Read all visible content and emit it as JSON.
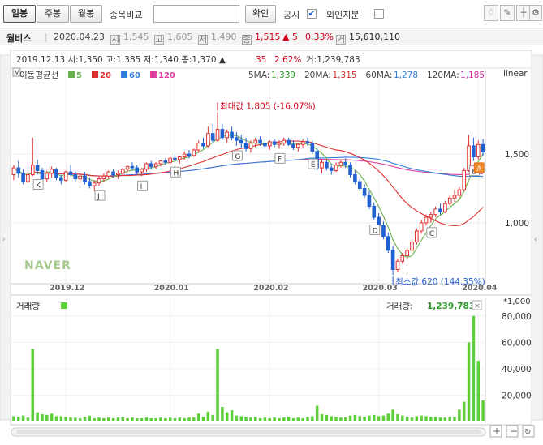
{
  "toolbar": {
    "period_buttons": [
      "일봉",
      "주봉",
      "월봉"
    ],
    "compare_label": "종목비교",
    "confirm_label": "확인",
    "disclosure_label": "공시",
    "foreign_label": "외인지분"
  },
  "info": {
    "name": "월비스",
    "date": "2020.04.23",
    "open": "1,545",
    "high": "1,605",
    "low": "1,490",
    "close": "1,515",
    "change": "▲ 5",
    "pct": "0.33%",
    "volume": "15,610,110"
  },
  "chart_header": {
    "text": "2019.12.13  시:1,350  고:1,385  저:1,340  종:1,370 ▲",
    "change": "35",
    "pct": "2.62%",
    "volume": "거:1,239,783"
  },
  "legend": {
    "title": "이동평균선",
    "ma": [
      {
        "label": "5",
        "color": "#6ab04c"
      },
      {
        "label": "20",
        "color": "#e03030"
      },
      {
        "label": "60",
        "color": "#2f7fd8"
      },
      {
        "label": "120",
        "color": "#e040a0"
      }
    ]
  },
  "ma_values": [
    {
      "label": "5MA:",
      "value": "1,339",
      "color": "#2a9a2a"
    },
    {
      "label": "20MA:",
      "value": "1,315",
      "color": "#d03030"
    },
    {
      "label": "60MA:",
      "value": "1,278",
      "color": "#2f7fd8"
    },
    {
      "label": "120MA:",
      "value": "1,185",
      "color": "#d030a0"
    }
  ],
  "scale_label": "linear",
  "watermark": "NAVER",
  "max_label": "최대값 1,805 (-16.07%)",
  "min_label": "최소값 620 (144.35%)",
  "volume_title": "거래량",
  "volume_value_label": "거래량:",
  "volume_value": "1,239,783",
  "volume_unit": "*1,000",
  "chart_data": {
    "type": "candlestick",
    "price_axis": {
      "ticks": [
        1000,
        1500
      ],
      "tick_labels": [
        "1,000",
        "1,500"
      ],
      "range": [
        580,
        2020
      ]
    },
    "x_ticks": [
      "2019.12",
      "2020.01",
      "2020.02",
      "2020.03",
      "2020.04"
    ],
    "volume_axis": {
      "ticks": [
        20000,
        40000,
        60000,
        80000
      ],
      "tick_labels": [
        "20,000",
        "40,000",
        "60,000",
        "80,000"
      ],
      "range": [
        0,
        86000
      ]
    },
    "candles": [
      [
        1350,
        1420,
        1310,
        1400
      ],
      [
        1400,
        1450,
        1330,
        1360
      ],
      [
        1360,
        1390,
        1280,
        1300
      ],
      [
        1300,
        1370,
        1290,
        1350
      ],
      [
        1350,
        1620,
        1340,
        1420
      ],
      [
        1420,
        1460,
        1350,
        1380
      ],
      [
        1380,
        1400,
        1300,
        1320
      ],
      [
        1320,
        1380,
        1300,
        1360
      ],
      [
        1360,
        1410,
        1330,
        1390
      ],
      [
        1390,
        1400,
        1310,
        1330
      ],
      [
        1330,
        1350,
        1280,
        1310
      ],
      [
        1310,
        1380,
        1300,
        1370
      ],
      [
        1370,
        1420,
        1340,
        1350
      ],
      [
        1350,
        1380,
        1300,
        1320
      ],
      [
        1320,
        1360,
        1290,
        1340
      ],
      [
        1340,
        1370,
        1280,
        1300
      ],
      [
        1300,
        1330,
        1250,
        1270
      ],
      [
        1270,
        1310,
        1230,
        1290
      ],
      [
        1290,
        1340,
        1270,
        1320
      ],
      [
        1320,
        1360,
        1300,
        1340
      ],
      [
        1340,
        1380,
        1320,
        1370
      ],
      [
        1370,
        1390,
        1330,
        1350
      ],
      [
        1350,
        1380,
        1320,
        1360
      ],
      [
        1360,
        1400,
        1340,
        1390
      ],
      [
        1390,
        1420,
        1370,
        1410
      ],
      [
        1410,
        1440,
        1380,
        1400
      ],
      [
        1400,
        1420,
        1350,
        1370
      ],
      [
        1370,
        1400,
        1340,
        1390
      ],
      [
        1390,
        1440,
        1370,
        1430
      ],
      [
        1430,
        1450,
        1390,
        1410
      ],
      [
        1410,
        1440,
        1390,
        1430
      ],
      [
        1430,
        1460,
        1410,
        1450
      ],
      [
        1450,
        1470,
        1420,
        1440
      ],
      [
        1440,
        1480,
        1420,
        1470
      ],
      [
        1470,
        1500,
        1440,
        1460
      ],
      [
        1460,
        1490,
        1430,
        1480
      ],
      [
        1480,
        1520,
        1460,
        1500
      ],
      [
        1500,
        1530,
        1470,
        1490
      ],
      [
        1490,
        1540,
        1480,
        1530
      ],
      [
        1530,
        1600,
        1510,
        1580
      ],
      [
        1580,
        1620,
        1540,
        1560
      ],
      [
        1560,
        1700,
        1550,
        1650
      ],
      [
        1650,
        1720,
        1580,
        1600
      ],
      [
        1600,
        1805,
        1590,
        1680
      ],
      [
        1680,
        1720,
        1600,
        1620
      ],
      [
        1620,
        1680,
        1580,
        1660
      ],
      [
        1660,
        1700,
        1600,
        1620
      ],
      [
        1620,
        1660,
        1560,
        1600
      ],
      [
        1600,
        1640,
        1540,
        1580
      ],
      [
        1580,
        1620,
        1520,
        1540
      ],
      [
        1540,
        1600,
        1510,
        1580
      ],
      [
        1580,
        1620,
        1550,
        1600
      ],
      [
        1600,
        1630,
        1560,
        1580
      ],
      [
        1580,
        1610,
        1540,
        1560
      ],
      [
        1560,
        1600,
        1530,
        1590
      ],
      [
        1590,
        1610,
        1550,
        1570
      ],
      [
        1570,
        1600,
        1540,
        1580
      ],
      [
        1580,
        1620,
        1560,
        1600
      ],
      [
        1600,
        1620,
        1560,
        1570
      ],
      [
        1570,
        1600,
        1530,
        1550
      ],
      [
        1550,
        1580,
        1520,
        1570
      ],
      [
        1570,
        1610,
        1550,
        1590
      ],
      [
        1590,
        1620,
        1560,
        1580
      ],
      [
        1580,
        1600,
        1500,
        1520
      ],
      [
        1520,
        1540,
        1380,
        1400
      ],
      [
        1400,
        1460,
        1360,
        1440
      ],
      [
        1440,
        1460,
        1380,
        1400
      ],
      [
        1400,
        1430,
        1350,
        1380
      ],
      [
        1380,
        1440,
        1370,
        1420
      ],
      [
        1420,
        1460,
        1400,
        1440
      ],
      [
        1440,
        1470,
        1400,
        1420
      ],
      [
        1420,
        1440,
        1330,
        1350
      ],
      [
        1350,
        1380,
        1280,
        1300
      ],
      [
        1300,
        1320,
        1230,
        1250
      ],
      [
        1250,
        1280,
        1180,
        1200
      ],
      [
        1200,
        1230,
        1100,
        1120
      ],
      [
        1120,
        1150,
        1020,
        1040
      ],
      [
        1040,
        1070,
        960,
        980
      ],
      [
        980,
        1010,
        880,
        900
      ],
      [
        900,
        930,
        780,
        800
      ],
      [
        800,
        830,
        620,
        660
      ],
      [
        660,
        740,
        640,
        720
      ],
      [
        720,
        780,
        700,
        760
      ],
      [
        760,
        820,
        740,
        800
      ],
      [
        800,
        880,
        780,
        860
      ],
      [
        860,
        960,
        840,
        940
      ],
      [
        940,
        1020,
        920,
        1000
      ],
      [
        1000,
        1060,
        980,
        1040
      ],
      [
        1040,
        1080,
        1000,
        1060
      ],
      [
        1060,
        1120,
        1040,
        1100
      ],
      [
        1100,
        1140,
        1060,
        1080
      ],
      [
        1080,
        1160,
        1070,
        1140
      ],
      [
        1140,
        1200,
        1120,
        1180
      ],
      [
        1180,
        1240,
        1150,
        1200
      ],
      [
        1200,
        1260,
        1180,
        1240
      ],
      [
        1240,
        1400,
        1230,
        1380
      ],
      [
        1380,
        1640,
        1370,
        1560
      ],
      [
        1560,
        1620,
        1450,
        1480
      ],
      [
        1480,
        1600,
        1460,
        1570
      ],
      [
        1570,
        1610,
        1490,
        1515
      ]
    ],
    "volume": [
      4000,
      3500,
      4500,
      3000,
      55000,
      7000,
      5500,
      5000,
      6000,
      4000,
      4000,
      3500,
      3000,
      3000,
      2500,
      3500,
      4500,
      2500,
      3000,
      2500,
      3000,
      2500,
      3000,
      3500,
      2500,
      3000,
      2500,
      2500,
      3000,
      2500,
      2500,
      3000,
      2500,
      3000,
      2500,
      3000,
      2500,
      3000,
      3000,
      6000,
      3500,
      7500,
      5000,
      55000,
      11000,
      7000,
      8500,
      4500,
      4000,
      3500,
      3000,
      3500,
      2500,
      3000,
      2500,
      3000,
      2500,
      3000,
      3500,
      2500,
      3000,
      2500,
      3500,
      4000,
      12000,
      5500,
      5000,
      4000,
      3500,
      3000,
      3000,
      4500,
      5000,
      4000,
      3500,
      4500,
      5000,
      4000,
      4500,
      6000,
      9000,
      5500,
      4500,
      3500,
      3000,
      4000,
      4500,
      4000,
      3500,
      3500,
      3000,
      3000,
      3500,
      3500,
      9000,
      15000,
      60000,
      80000,
      46000,
      16000
    ],
    "markers": [
      {
        "label": "K",
        "index": 5
      },
      {
        "label": "J",
        "index": 18
      },
      {
        "label": "I",
        "index": 27
      },
      {
        "label": "H",
        "index": 34
      },
      {
        "label": "G",
        "index": 47
      },
      {
        "label": "F",
        "index": 56
      },
      {
        "label": "E",
        "index": 63
      },
      {
        "label": "D",
        "index": 76
      },
      {
        "label": "C",
        "index": 88
      },
      {
        "label": "B",
        "index": 97
      },
      {
        "label": "A",
        "index": 98
      }
    ]
  }
}
